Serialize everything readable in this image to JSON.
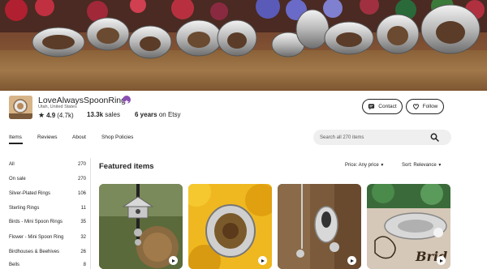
{
  "shop": {
    "name": "LoveAlwaysSpoonRings",
    "location": "Utah, United States",
    "rating": "4.9",
    "reviews_count": "(4.7k)",
    "sales_value": "13.3k",
    "sales_label": "sales",
    "years_value": "6 years",
    "years_label": "on Etsy"
  },
  "actions": {
    "contact_label": "Contact",
    "follow_label": "Follow"
  },
  "tabs": [
    {
      "label": "Items"
    },
    {
      "label": "Reviews"
    },
    {
      "label": "About"
    },
    {
      "label": "Shop Policies"
    }
  ],
  "search": {
    "placeholder": "Search all 270 items"
  },
  "sidebar": {
    "items": [
      {
        "label": "All",
        "count": "270"
      },
      {
        "label": "On sale",
        "count": "270"
      },
      {
        "label": "Silver-Plated Rings",
        "count": "106"
      },
      {
        "label": "Sterling Rings",
        "count": "11"
      },
      {
        "label": "Birds - Mini Spoon Rings",
        "count": "35"
      },
      {
        "label": "Flower - Mini Spoon Ring",
        "count": "32"
      },
      {
        "label": "Birdhouses & Beehives",
        "count": "26"
      },
      {
        "label": "Bells",
        "count": "8"
      }
    ]
  },
  "featured": {
    "title": "Featured items",
    "price_filter": "Price: Any price",
    "sort_filter": "Sort: Relevance",
    "card_text": "Brid"
  },
  "colors": {
    "badge": "#8a4fb3",
    "text": "#222222",
    "muted": "#595959",
    "search_bg": "#efefef"
  }
}
